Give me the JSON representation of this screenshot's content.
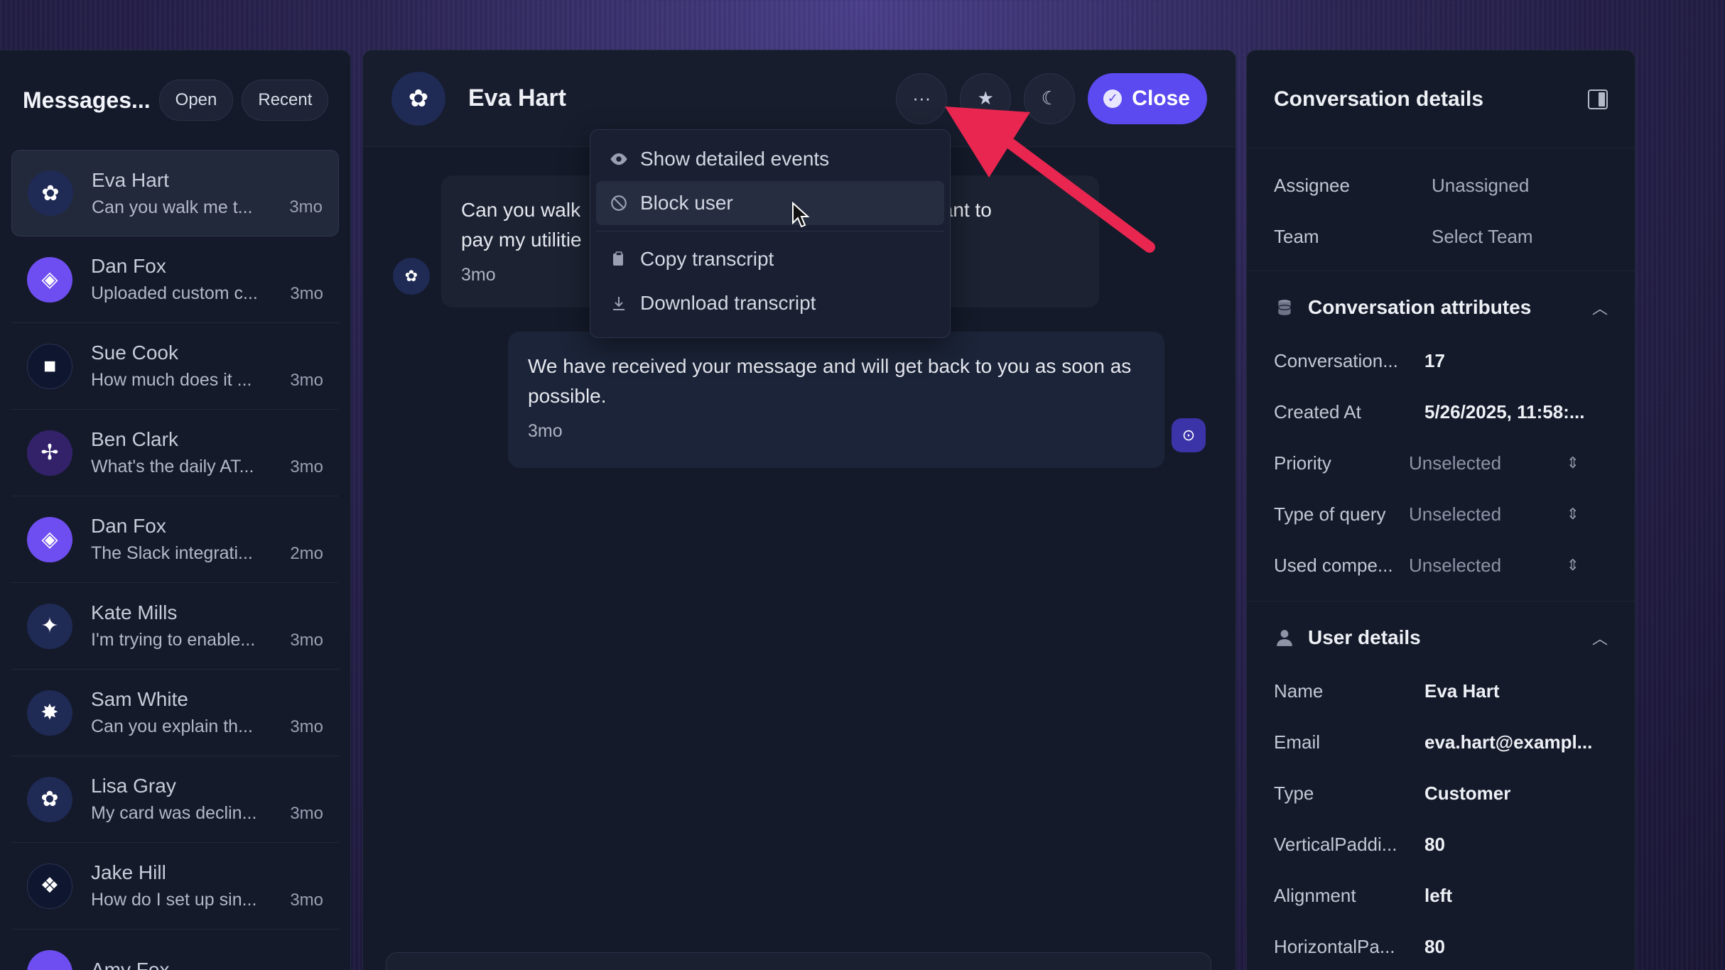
{
  "sidebar": {
    "title": "Messages...",
    "filters": [
      "Open",
      "Recent"
    ],
    "conversations": [
      {
        "name": "Eva Hart",
        "preview": "Can you walk me t...",
        "time": "3mo",
        "avatar_icon": "flower-icon"
      },
      {
        "name": "Dan Fox",
        "preview": "Uploaded custom c...",
        "time": "3mo",
        "avatar_icon": "diamond-icon"
      },
      {
        "name": "Sue Cook",
        "preview": "How much does it ...",
        "time": "3mo",
        "avatar_icon": "square-icon"
      },
      {
        "name": "Ben Clark",
        "preview": "What's the daily AT...",
        "time": "3mo",
        "avatar_icon": "nodes-icon"
      },
      {
        "name": "Dan Fox",
        "preview": "The Slack integrati...",
        "time": "2mo",
        "avatar_icon": "diamond-icon"
      },
      {
        "name": "Kate Mills",
        "preview": "I'm trying to enable...",
        "time": "3mo",
        "avatar_icon": "sparkle-icon"
      },
      {
        "name": "Sam White",
        "preview": "Can you explain th...",
        "time": "3mo",
        "avatar_icon": "star-icon"
      },
      {
        "name": "Lisa Gray",
        "preview": "My card was declin...",
        "time": "3mo",
        "avatar_icon": "flower-icon"
      },
      {
        "name": "Jake Hill",
        "preview": "How do I set up sin...",
        "time": "3mo",
        "avatar_icon": "blob-icon"
      },
      {
        "name": "Amy Fox",
        "preview": "",
        "time": "",
        "avatar_icon": "smile-icon"
      }
    ]
  },
  "chat": {
    "contact_name": "Eva Hart",
    "close_label": "Close",
    "incoming": {
      "text_start": "Can you walk",
      "text_end": "ay? I want to",
      "line2": "pay my utilitie",
      "time": "3mo"
    },
    "outgoing": {
      "text": "We have received your message and will get back to you as soon as possible.",
      "time": "3mo"
    },
    "menu": [
      {
        "label": "Show detailed events",
        "icon": "eye-icon"
      },
      {
        "label": "Block user",
        "icon": "block-icon"
      },
      {
        "label": "Copy transcript",
        "icon": "clipboard-icon"
      },
      {
        "label": "Download transcript",
        "icon": "download-icon"
      }
    ]
  },
  "details": {
    "title": "Conversation details",
    "assignee_label": "Assignee",
    "assignee_value": "Unassigned",
    "team_label": "Team",
    "team_value": "Select Team",
    "attributes_title": "Conversation attributes",
    "attributes": [
      {
        "label": "Conversation...",
        "value": "17"
      },
      {
        "label": "Created At",
        "value": "5/26/2025, 11:58:..."
      }
    ],
    "selects": [
      {
        "label": "Priority",
        "value": "Unselected"
      },
      {
        "label": "Type of query",
        "value": "Unselected"
      },
      {
        "label": "Used compe...",
        "value": "Unselected"
      }
    ],
    "user_title": "User details",
    "user": [
      {
        "label": "Name",
        "value": "Eva Hart"
      },
      {
        "label": "Email",
        "value": "eva.hart@exampl..."
      },
      {
        "label": "Type",
        "value": "Customer"
      },
      {
        "label": "VerticalPaddi...",
        "value": "80"
      },
      {
        "label": "Alignment",
        "value": "left"
      },
      {
        "label": "HorizontalPa...",
        "value": "80"
      }
    ]
  },
  "colors": {
    "accent": "#5a4af0",
    "arrow": "#e8264f",
    "panel": "#141a2a"
  }
}
